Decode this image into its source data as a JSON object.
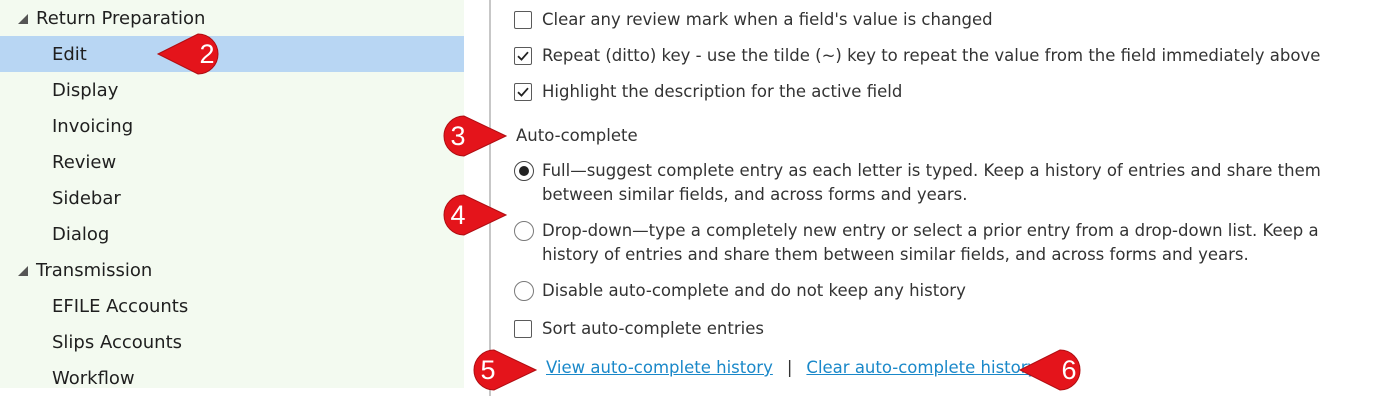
{
  "tree": {
    "items": [
      {
        "type": "group",
        "label": "Return Preparation"
      },
      {
        "type": "child",
        "label": "Edit",
        "selected": true
      },
      {
        "type": "child",
        "label": "Display"
      },
      {
        "type": "child",
        "label": "Invoicing"
      },
      {
        "type": "child",
        "label": "Review"
      },
      {
        "type": "child",
        "label": "Sidebar"
      },
      {
        "type": "child",
        "label": "Dialog"
      },
      {
        "type": "group",
        "label": "Transmission"
      },
      {
        "type": "child",
        "label": "EFILE Accounts"
      },
      {
        "type": "child",
        "label": "Slips Accounts"
      },
      {
        "type": "child",
        "label": "Workflow"
      }
    ]
  },
  "options": {
    "clear_review": {
      "label": "Clear any review mark when a field's value is changed",
      "checked": false
    },
    "repeat_key": {
      "label": "Repeat (ditto) key - use the tilde (~) key to repeat the value from the field immediately above",
      "checked": true
    },
    "highlight": {
      "label": "Highlight the description for the active field",
      "checked": true
    }
  },
  "autocomplete": {
    "title": "Auto-complete",
    "full": {
      "label": "Full—suggest complete entry as each letter is typed. Keep a history of entries and share them between similar fields, and across forms and years.",
      "selected": true
    },
    "dropdown": {
      "label": "Drop-down—type a completely new entry or select a prior entry from a drop-down list. Keep a history of entries and share them between similar fields, and across forms and years.",
      "selected": false
    },
    "disable": {
      "label": "Disable auto-complete and do not keep any history",
      "selected": false
    },
    "sort": {
      "label": "Sort auto-complete entries",
      "checked": false
    },
    "view_history_link": "View auto-complete history",
    "separator": "|",
    "clear_history_link": "Clear auto-complete history"
  },
  "callouts": {
    "c2": "2",
    "c3": "3",
    "c4": "4",
    "c5": "5",
    "c6": "6",
    "color": "#e4141b"
  },
  "colors": {
    "tree_bg": "#f3faf0",
    "selected_bg": "#b8d6f3",
    "link": "#1a88c9"
  }
}
